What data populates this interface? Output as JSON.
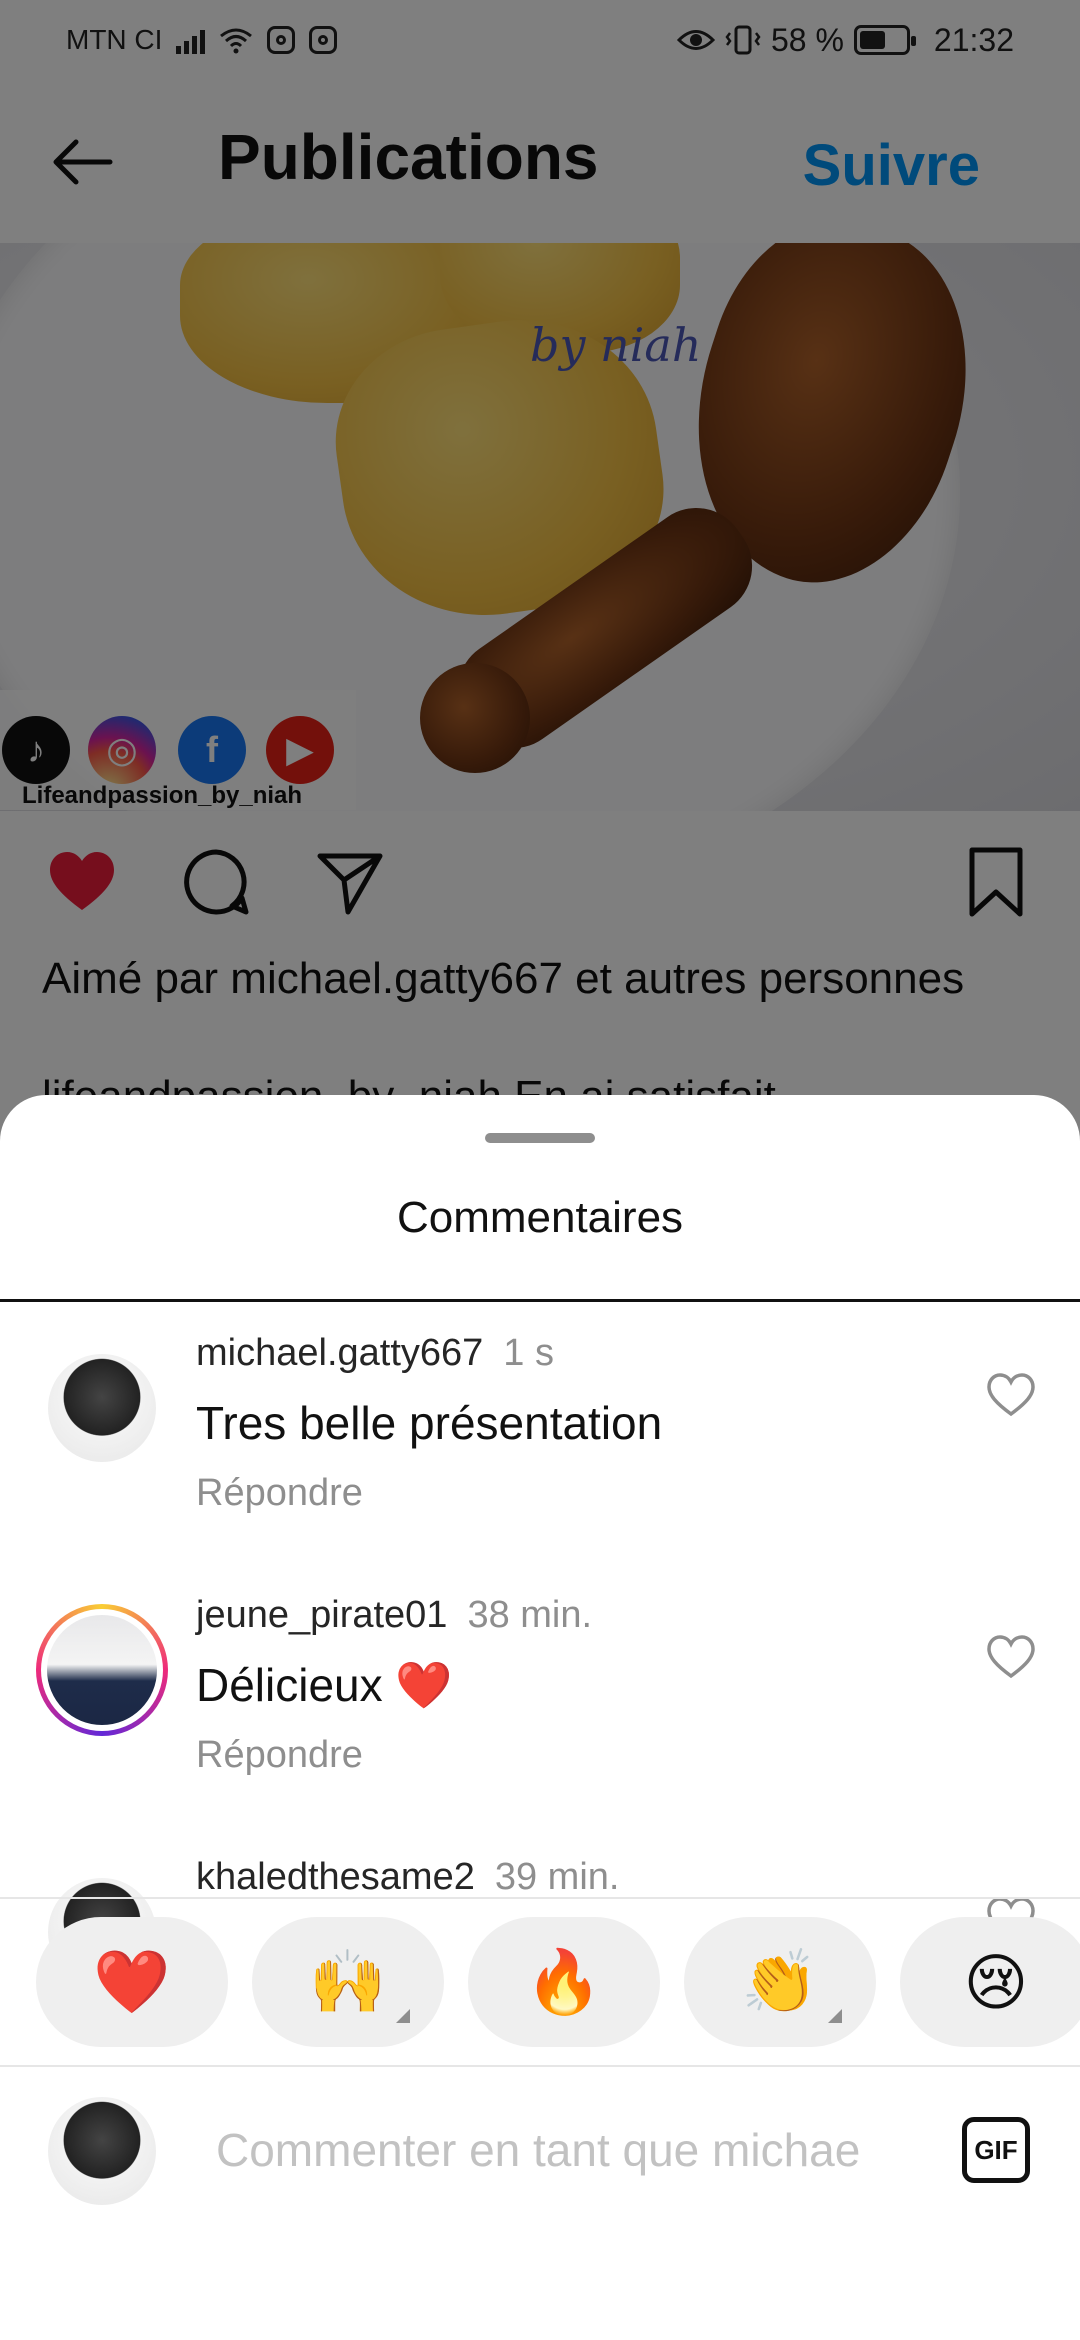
{
  "status_bar": {
    "carrier": "MTN CI",
    "battery_percent": "58 %",
    "time": "21:32",
    "battery_level": 0.58
  },
  "header": {
    "back_icon": "arrow-left-icon",
    "title": "Publications",
    "follow_label": "Suivre"
  },
  "post": {
    "watermark": "by niah",
    "social_label": "Lifeandpassion_by_niah",
    "liked_prefix": "Aimé par ",
    "liked_user": "michael.gatty667",
    "liked_suffix": " et autres personnes",
    "caption_peek": "lifeandpassion_by_niah En ai satisfait"
  },
  "comments_sheet": {
    "title": "Commentaires",
    "comments": [
      {
        "user": "michael.gatty667",
        "time": "1 s",
        "text": "Tres belle présentation",
        "reply": "Répondre"
      },
      {
        "user": "jeune_pirate01",
        "time": "38 min.",
        "text": "Délicieux ❤️",
        "reply": "Répondre"
      },
      {
        "user": "khaledthesame2",
        "time": "39 min.",
        "text": "",
        "reply": ""
      }
    ],
    "reactions": [
      "❤️",
      "🙌",
      "🔥",
      "👏",
      "😢"
    ],
    "composer_placeholder": "Commenter en tant que michae",
    "gif_label": "GIF"
  },
  "colors": {
    "accent": "#0095f6",
    "like_red": "#ed1c3a",
    "muted": "#8e8e8e"
  }
}
